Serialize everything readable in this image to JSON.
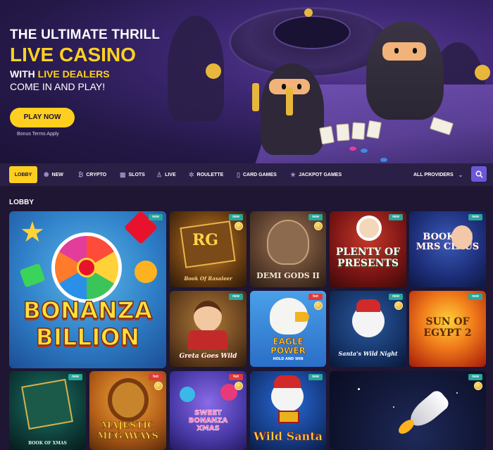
{
  "hero": {
    "line1": "THE ULTIMATE THRILL",
    "line2": "LIVE CASINO",
    "line3_prefix": "WITH ",
    "line3_highlight": "LIVE DEALERS",
    "line4": "COME IN AND PLAY!",
    "cta_label": "PLAY NOW",
    "terms": "Bonus Terms Apply"
  },
  "nav": {
    "items": [
      {
        "label": "LOBBY",
        "icon": "none"
      },
      {
        "label": "NEW",
        "icon": "sparkle-icon"
      },
      {
        "label": "CRYPTO",
        "icon": "bitcoin-icon"
      },
      {
        "label": "SLOTS",
        "icon": "slots-icon"
      },
      {
        "label": "LIVE",
        "icon": "person-icon"
      },
      {
        "label": "ROULETTE",
        "icon": "roulette-icon"
      },
      {
        "label": "CARD GAMES",
        "icon": "cards-icon"
      },
      {
        "label": "JACKPOT GAMES",
        "icon": "star-icon"
      }
    ],
    "providers": "ALL PROVIDERS",
    "search_icon": "search-icon"
  },
  "lobby": {
    "title": "LOBBY",
    "tiles": [
      {
        "title": "BONANZA BILLION",
        "badge": "new"
      },
      {
        "title": "Book Of Rasaleer",
        "badge": "new"
      },
      {
        "title": "DEMI GODS II",
        "badge": "new"
      },
      {
        "title": "PLENTY OF PRESENTS",
        "badge": "new"
      },
      {
        "title": "BOOK OF MRS CLAUS",
        "badge": "new"
      },
      {
        "title": "Greta Goes Wild",
        "badge": "new"
      },
      {
        "title": "EAGLE POWER",
        "subtitle": "HOLD AND WIN",
        "badge": "hot"
      },
      {
        "title": "Santa's Wild Night",
        "badge": "new"
      },
      {
        "title": "SUN OF EGYPT 2",
        "badge": "new"
      },
      {
        "title": "BOOK OF XMAS",
        "badge": "new"
      },
      {
        "title": "MAJESTIC MEGAWAYS",
        "badge": "hot"
      },
      {
        "title": "SWEET BONANZA XMAS",
        "badge": "hot"
      },
      {
        "title": "Wild Santa",
        "badge": "new"
      },
      {
        "title": "",
        "badge": "new"
      }
    ]
  },
  "colors": {
    "accent": "#ffcf1f",
    "new_badge": "#2aa79b",
    "hot_badge": "#e03a3a",
    "search_button": "#6b58d8"
  }
}
